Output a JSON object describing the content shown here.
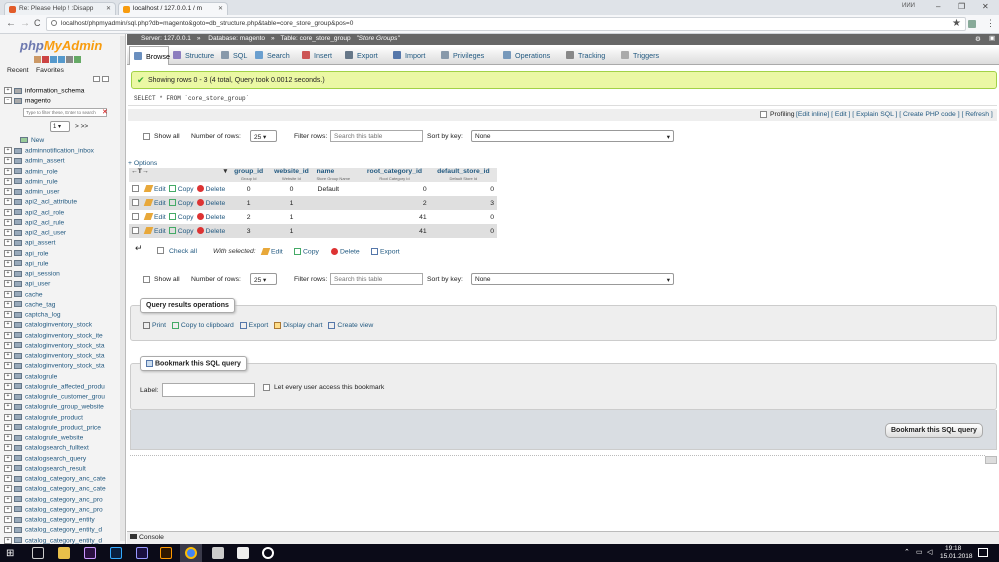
{
  "browser": {
    "tabs": [
      {
        "title": "Re: Please Help ! :Disapp"
      },
      {
        "title": "localhost / 127.0.0.1 / m"
      }
    ],
    "url": "localhost/phpmyadmin/sql.php?db=magento&goto=db_structure.php&table=core_store_group&pos=0",
    "user": "ИИИ",
    "win_min": "–",
    "win_max": "❐",
    "win_close": "✕",
    "back": "←",
    "forward": "→",
    "reload": "C",
    "star": "★"
  },
  "sidebar": {
    "logo_php": "php",
    "logo_my": "MyAdmin",
    "links": [
      "Recent",
      "Favorites"
    ],
    "dbs": [
      {
        "name": "information_schema"
      },
      {
        "name": "magento"
      }
    ],
    "filter_placeholder": "Type to filter these, Enter to search",
    "page": "1",
    "nav": "> >>",
    "new_label": "New",
    "tables": [
      "adminnotification_inbox",
      "admin_assert",
      "admin_role",
      "admin_rule",
      "admin_user",
      "api2_acl_attribute",
      "api2_acl_role",
      "api2_acl_rule",
      "api2_acl_user",
      "api_assert",
      "api_role",
      "api_rule",
      "api_session",
      "api_user",
      "cache",
      "cache_tag",
      "captcha_log",
      "cataloginventory_stock",
      "cataloginventory_stock_ite",
      "cataloginventory_stock_sta",
      "cataloginventory_stock_sta",
      "cataloginventory_stock_sta",
      "catalogrule",
      "catalogrule_affected_produ",
      "catalogrule_customer_grou",
      "catalogrule_group_website",
      "catalogrule_product",
      "catalogrule_product_price",
      "catalogrule_website",
      "catalogsearch_fulltext",
      "catalogsearch_query",
      "catalogsearch_result",
      "catalog_category_anc_cate",
      "catalog_category_anc_cate",
      "catalog_category_anc_pro",
      "catalog_category_anc_pro",
      "catalog_category_entity",
      "catalog_category_entity_d",
      "catalog_category_entity_d"
    ]
  },
  "breadcrumb": {
    "server": "Server: 127.0.0.1",
    "database": "Database: magento",
    "table": "Table: core_store_group",
    "comment": "\"Store Groups\""
  },
  "tabs": [
    {
      "label": "Browse",
      "color": "#6a8fbf"
    },
    {
      "label": "Structure",
      "color": "#8c7dbf"
    },
    {
      "label": "SQL",
      "color": "#8899aa"
    },
    {
      "label": "Search",
      "color": "#6a9fcf"
    },
    {
      "label": "Insert",
      "color": "#cc5555"
    },
    {
      "label": "Export",
      "color": "#667788"
    },
    {
      "label": "Import",
      "color": "#5577aa"
    },
    {
      "label": "Privileges",
      "color": "#8899aa"
    },
    {
      "label": "Operations",
      "color": "#7799bb"
    },
    {
      "label": "Tracking",
      "color": "#888"
    },
    {
      "label": "Triggers",
      "color": "#aaa"
    }
  ],
  "message": "Showing rows 0 - 3 (4 total, Query took 0.0012 seconds.)",
  "sql_query": "SELECT * FROM `core_store_group`",
  "profiling": {
    "label": "Profiling",
    "links": "[Edit inline] [ Edit ] [ Explain SQL ] [ Create PHP code ] [ Refresh ]"
  },
  "controls": {
    "show_all": "Show all",
    "rows_label": "Number of rows:",
    "rows_value": "25",
    "filter_label": "Filter rows:",
    "filter_placeholder": "Search this table",
    "sort_label": "Sort by key:",
    "sort_value": "None"
  },
  "options_link": "+ Options",
  "nav_arrows": "←T→",
  "columns": [
    {
      "name": "group_id",
      "comment": "Group Id"
    },
    {
      "name": "website_id",
      "comment": "Website Id"
    },
    {
      "name": "name",
      "comment": "Store Group Name"
    },
    {
      "name": "root_category_id",
      "comment": "Root Category Id"
    },
    {
      "name": "default_store_id",
      "comment": "Default Store Id"
    }
  ],
  "row_actions": {
    "edit": "Edit",
    "copy": "Copy",
    "delete": "Delete"
  },
  "rows": [
    [
      "0",
      "0",
      "Default",
      "0",
      "0"
    ],
    [
      "1",
      "1",
      "",
      "2",
      "3"
    ],
    [
      "2",
      "1",
      "",
      "41",
      "0"
    ],
    [
      "3",
      "1",
      "",
      "41",
      "0"
    ]
  ],
  "with_selected": {
    "check_all": "Check all",
    "label": "With selected:",
    "edit": "Edit",
    "copy": "Copy",
    "delete": "Delete",
    "export": "Export"
  },
  "query_ops": {
    "legend": "Query results operations",
    "print": "Print",
    "copy": "Copy to clipboard",
    "export": "Export",
    "chart": "Display chart",
    "view": "Create view"
  },
  "bookmark": {
    "legend": "Bookmark this SQL query",
    "label": "Label:",
    "share": "Let every user access this bookmark",
    "button": "Bookmark this SQL query"
  },
  "console": "Console",
  "taskbar": {
    "time": "19:18",
    "date": "15.01.2018"
  }
}
